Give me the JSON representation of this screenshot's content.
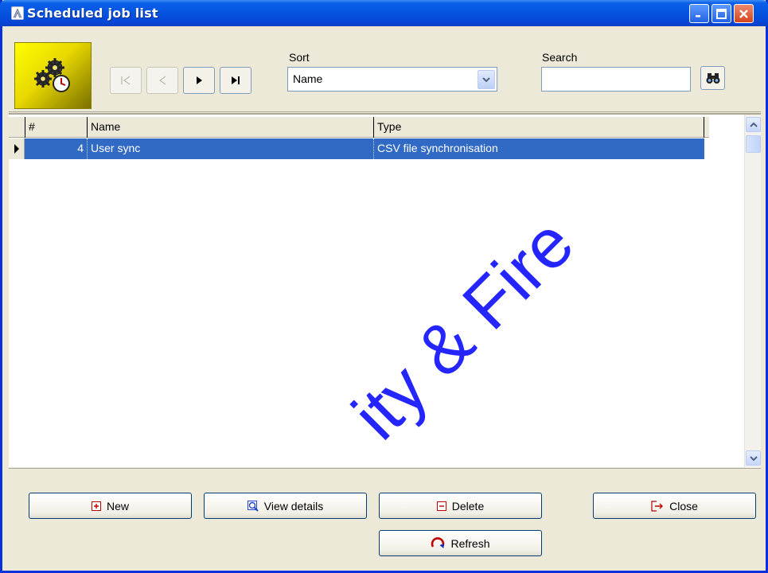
{
  "window": {
    "title": "Scheduled job list"
  },
  "icons": {
    "logo": "gears-clock-icon",
    "first": "first-record-icon",
    "prev": "previous-record-icon",
    "next": "next-record-icon",
    "last": "last-record-icon",
    "search": "binoculars-icon",
    "new": "plus-box-icon",
    "view": "magnifier-icon",
    "delete": "minus-box-icon",
    "close": "exit-arrow-icon",
    "refresh": "refresh-icon"
  },
  "toolbar": {
    "sort_label": "Sort",
    "sort_value": "Name",
    "search_label": "Search",
    "search_value": ""
  },
  "grid": {
    "columns": [
      "#",
      "Name",
      "Type"
    ],
    "rows": [
      {
        "num": "4",
        "name": "User sync",
        "type": "CSV file synchronisation",
        "selected": true
      }
    ]
  },
  "buttons": {
    "new": "New",
    "view": "View details",
    "delete": "Delete",
    "close": "Close",
    "refresh": "Refresh"
  },
  "watermark": "ity & Fire",
  "colors": {
    "selection": "#316ac5",
    "titlebar": "#0554e0",
    "watermark": "#1a1aff"
  }
}
